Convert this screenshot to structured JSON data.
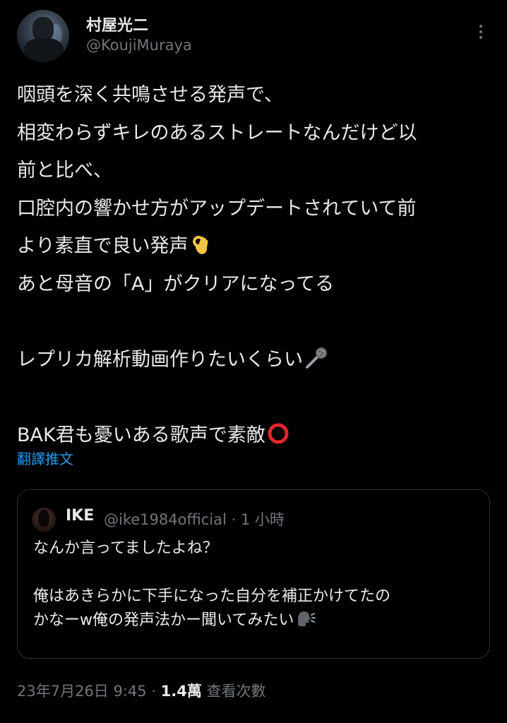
{
  "author": {
    "display_name": "村屋光二",
    "handle": "@KoujiMuraya"
  },
  "tweet": {
    "lines": [
      "咽頭を深く共鳴させる発声で、",
      "相変わらずキレのあるストレートなんだけど以",
      "前と比べ、",
      "口腔内の響かせ方がアップデートされていて前",
      "より素直で良い発声",
      "あと母音の「A」がクリアになってる",
      "",
      "レプリカ解析動画作りたいくらい",
      "",
      "BAK君も憂いある歌声で素敵"
    ],
    "emoji": {
      "ok_hand": "ok-hand-emoji",
      "microphone": "microphone-emoji",
      "red_circle": "heavy-large-circle-emoji"
    }
  },
  "translate_label": "翻譯推文",
  "quoted": {
    "name": "IKE",
    "meta": "@ike1984official · 1 小時",
    "lines": [
      "なんか言ってましたよね？",
      "",
      "俺はあきらかに下手になった自分を補正かけてたの",
      "かなーw俺の発声法かー聞いてみたい"
    ],
    "emoji": "speaking-head-emoji"
  },
  "footer": {
    "timestamp": "23年7月26日 9:45 · ",
    "views_count": "1.4萬",
    "views_label": " 查看次數"
  },
  "colors": {
    "background": "#000000",
    "text": "#e7e9ea",
    "secondary": "#71767b",
    "link": "#1d9bf0",
    "border": "#2f3336"
  }
}
